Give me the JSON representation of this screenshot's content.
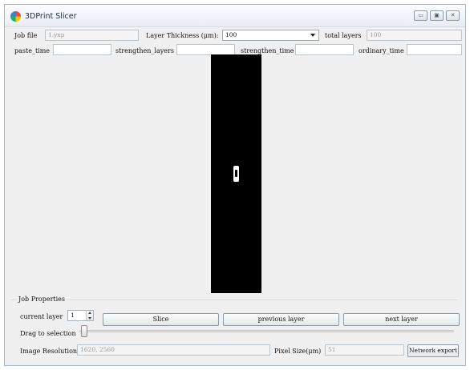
{
  "window": {
    "title": "3DPrint Slicer",
    "controls": {
      "minimize": "▭",
      "maximize": "▣",
      "close": "✕"
    }
  },
  "top_row": {
    "job_file_label": "Job file",
    "job_file_value": "1.yxp",
    "layer_thickness_label": "Layer Thickness (μm):",
    "layer_thickness_value": "100",
    "total_layers_label": "total layers",
    "total_layers_value": "100"
  },
  "params_row": {
    "paste_time_label": "paste_time",
    "paste_time_value": "",
    "strengthen_layers_label": "strengthen_layers",
    "strengthen_layers_value": "",
    "strengthen_time_label": "strengthen_time",
    "strengthen_time_value": "",
    "ordinary_time_label": "ordinary_time",
    "ordinary_time_value": ""
  },
  "job_properties": {
    "title": "Job Properties",
    "current_layer_label": "current  layer",
    "current_layer_value": "1",
    "slice_button": "Slice",
    "previous_layer_button": "previous layer",
    "next_layer_button": "next layer",
    "drag_label": "Drag to selection",
    "drag_value": 0,
    "image_resolution_label": "Image Resolution",
    "image_resolution_value": "1620, 2560",
    "pixel_size_label": "Pixel Size(μm)",
    "pixel_size_value": "51",
    "network_export_button": "Network export"
  },
  "colors": {
    "window_bg": "#f0f0f0",
    "preview_bg": "#000000",
    "slice_shape": "#ffffff"
  },
  "icons": {
    "app": "app-logo-icon",
    "dropdown": "chevron-down-icon",
    "spin_up": "arrow-up-icon",
    "spin_down": "arrow-down-icon"
  }
}
